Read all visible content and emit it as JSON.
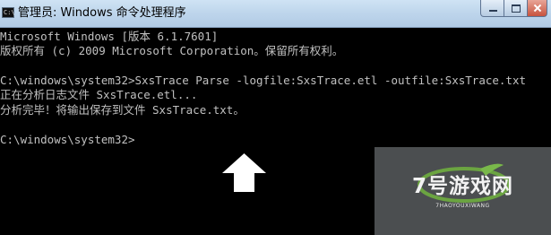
{
  "window": {
    "title": "管理员: Windows 命令处理程序",
    "icon_label": "C:\\"
  },
  "console": {
    "lines": [
      "Microsoft Windows [版本 6.1.7601]",
      "版权所有 (c) 2009 Microsoft Corporation。保留所有权利。",
      "C:\\windows\\system32>SxsTrace Parse -logfile:SxsTrace.etl -outfile:SxsTrace.txt",
      "正在分析日志文件 SxsTrace.etl...",
      "分析完毕！将输出保存到文件 SxsTrace.txt。",
      "C:\\windows\\system32>"
    ]
  },
  "watermark": {
    "text": "7号游戏网",
    "subtext": "7HAOYOUXIWANG"
  },
  "colors": {
    "console_bg": "#000000",
    "console_fg": "#c0c0c0",
    "titlebar": "#bfd6ec",
    "watermark_bg": "#4b4e50",
    "close_button": "#c7533e"
  }
}
